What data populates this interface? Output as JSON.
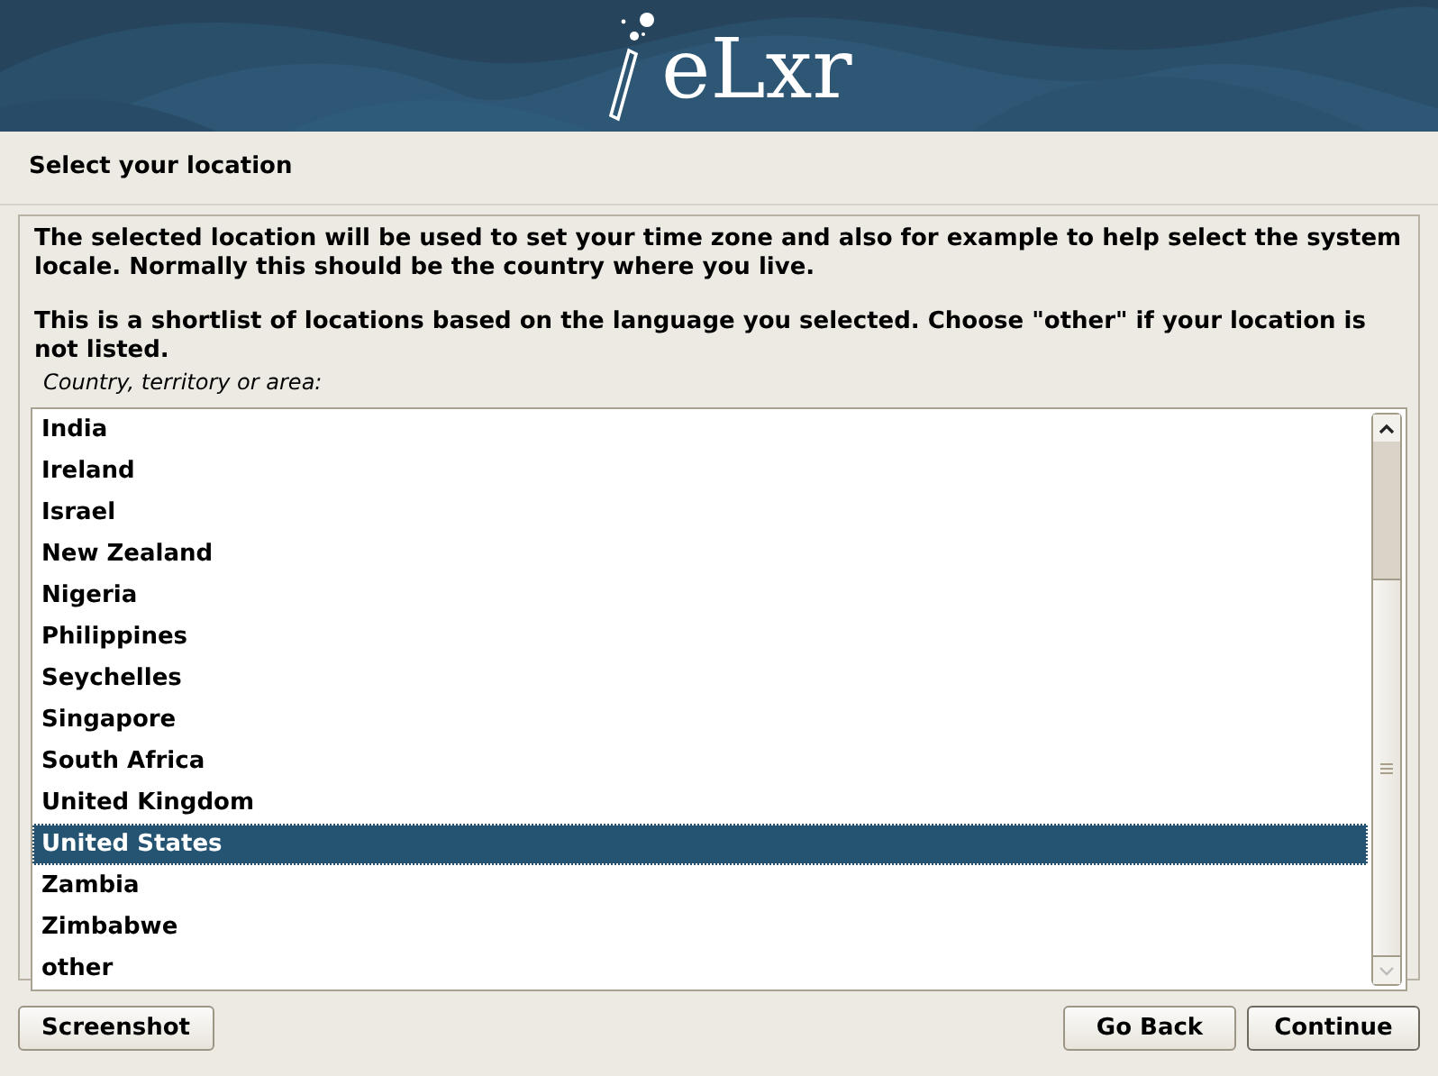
{
  "header": {
    "logo": "eLxr"
  },
  "title": "Select your location",
  "description": [
    "The selected location will be used to set your time zone and also for example to help select the system locale. Normally this should be the country where you live.",
    "This is a shortlist of locations based on the language you selected. Choose \"other\" if your location is not listed."
  ],
  "list": {
    "label": "Country, territory or area:",
    "items": [
      {
        "label": "India",
        "selected": false
      },
      {
        "label": "Ireland",
        "selected": false
      },
      {
        "label": "Israel",
        "selected": false
      },
      {
        "label": "New Zealand",
        "selected": false
      },
      {
        "label": "Nigeria",
        "selected": false
      },
      {
        "label": "Philippines",
        "selected": false
      },
      {
        "label": "Seychelles",
        "selected": false
      },
      {
        "label": "Singapore",
        "selected": false
      },
      {
        "label": "South Africa",
        "selected": false
      },
      {
        "label": "United Kingdom",
        "selected": false
      },
      {
        "label": "United States",
        "selected": true
      },
      {
        "label": "Zambia",
        "selected": false
      },
      {
        "label": "Zimbabwe",
        "selected": false
      },
      {
        "label": "other",
        "selected": false
      }
    ]
  },
  "buttons": {
    "left": [
      "Screenshot"
    ],
    "right": [
      "Go Back",
      "Continue"
    ]
  }
}
